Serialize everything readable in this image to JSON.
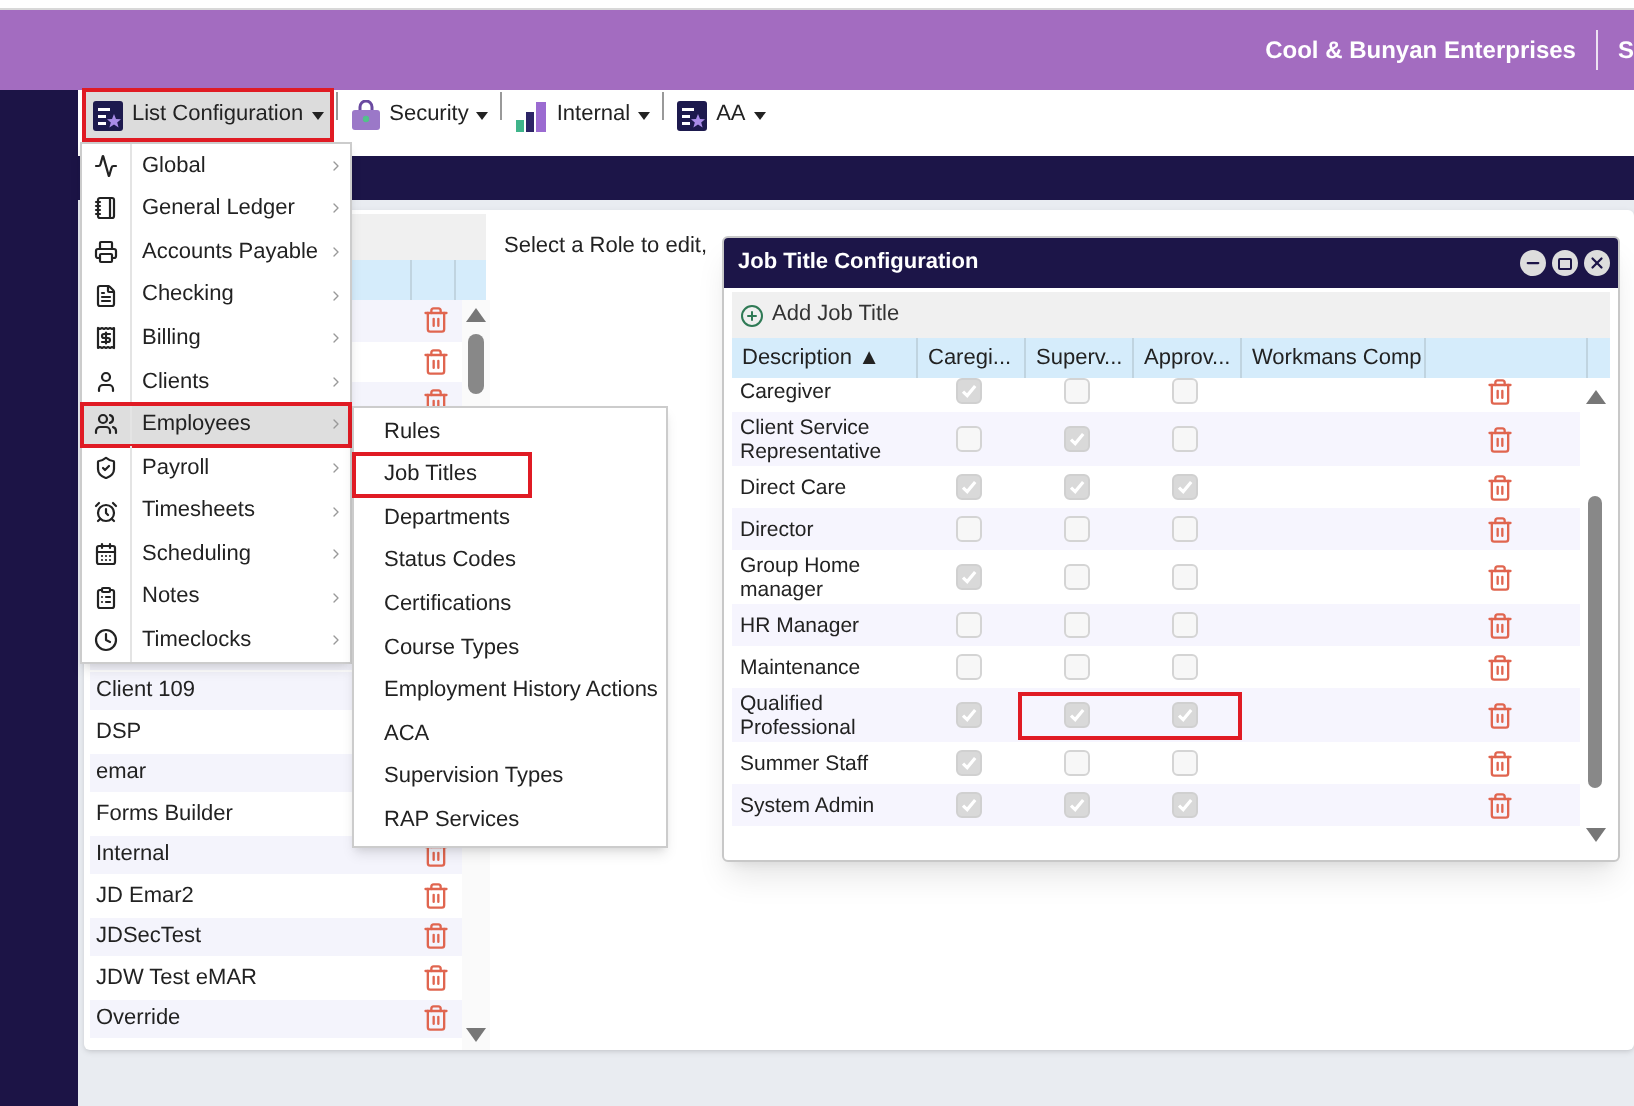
{
  "header": {
    "company": "Cool & Bunyan Enterprises",
    "cut_item": "S"
  },
  "toolbar": [
    {
      "label": "List Configuration",
      "selected": true,
      "annotated": true,
      "kind": "list"
    },
    {
      "label": "Security",
      "selected": false,
      "annotated": false,
      "kind": "security"
    },
    {
      "label": "Internal",
      "selected": false,
      "annotated": false,
      "kind": "internal"
    },
    {
      "label": "AA",
      "selected": false,
      "annotated": false,
      "kind": "list"
    }
  ],
  "menu": [
    {
      "label": "Global",
      "selected": false,
      "annotated": false
    },
    {
      "label": "General Ledger",
      "selected": false,
      "annotated": false
    },
    {
      "label": "Accounts Payable",
      "selected": false,
      "annotated": false
    },
    {
      "label": "Checking",
      "selected": false,
      "annotated": false
    },
    {
      "label": "Billing",
      "selected": false,
      "annotated": false
    },
    {
      "label": "Clients",
      "selected": false,
      "annotated": false
    },
    {
      "label": "Employees",
      "selected": true,
      "annotated": true
    },
    {
      "label": "Payroll",
      "selected": false,
      "annotated": false
    },
    {
      "label": "Timesheets",
      "selected": false,
      "annotated": false
    },
    {
      "label": "Scheduling",
      "selected": false,
      "annotated": false
    },
    {
      "label": "Notes",
      "selected": false,
      "annotated": false
    },
    {
      "label": "Timeclocks",
      "selected": false,
      "annotated": false
    }
  ],
  "submenu": [
    {
      "label": "Rules",
      "annotated": false
    },
    {
      "label": "Job Titles",
      "annotated": true
    },
    {
      "label": "Departments",
      "annotated": false
    },
    {
      "label": "Status Codes",
      "annotated": false
    },
    {
      "label": "Certifications",
      "annotated": false
    },
    {
      "label": "Course Types",
      "annotated": false
    },
    {
      "label": "Employment History Actions",
      "annotated": false
    },
    {
      "label": "ACA",
      "annotated": false
    },
    {
      "label": "Supervision Types",
      "annotated": false
    },
    {
      "label": "RAP Services",
      "annotated": false
    }
  ],
  "roles": [
    "Client 109",
    "DSP",
    "emar",
    "Forms Builder",
    "Internal",
    "JD Emar2",
    "JDSecTest",
    "JDW Test eMAR",
    "Override"
  ],
  "prompt": "Select a Role to edit,",
  "dialog": {
    "title": "Job Title Configuration",
    "add_label": "Add Job Title",
    "columns": [
      "Description ▲",
      "Caregi...",
      "Superv...",
      "Approv...",
      "Workmans Comp"
    ],
    "rows": [
      {
        "description": "Caregiver",
        "caregiver": true,
        "supervisor": false,
        "approver": false,
        "annotated": false
      },
      {
        "description": "Client Service Representative",
        "caregiver": false,
        "supervisor": true,
        "approver": false,
        "annotated": false
      },
      {
        "description": "Direct Care",
        "caregiver": true,
        "supervisor": true,
        "approver": true,
        "annotated": false
      },
      {
        "description": "Director",
        "caregiver": false,
        "supervisor": false,
        "approver": false,
        "annotated": false
      },
      {
        "description": "Group Home manager",
        "caregiver": true,
        "supervisor": false,
        "approver": false,
        "annotated": false
      },
      {
        "description": "HR Manager",
        "caregiver": false,
        "supervisor": false,
        "approver": false,
        "annotated": false
      },
      {
        "description": "Maintenance",
        "caregiver": false,
        "supervisor": false,
        "approver": false,
        "annotated": false
      },
      {
        "description": "Qualified Professional",
        "caregiver": true,
        "supervisor": true,
        "approver": true,
        "annotated": true
      },
      {
        "description": "Summer Staff",
        "caregiver": true,
        "supervisor": false,
        "approver": false,
        "annotated": false
      },
      {
        "description": "System Admin",
        "caregiver": true,
        "supervisor": true,
        "approver": true,
        "annotated": false
      }
    ]
  }
}
